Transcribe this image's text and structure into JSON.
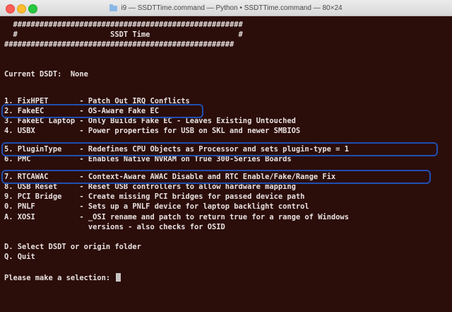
{
  "window": {
    "title": "i9 — SSDTTime.command — Python • SSDTTime.command — 80×24"
  },
  "terminal": {
    "hash_line_1": "  ####################################################",
    "header_line": "  #                     SSDT Time                    #",
    "hash_line_2": "####################################################",
    "current_dsdt": "Current DSDT:  None",
    "menu": [
      "1. FixHPET       - Patch Out IRQ Conflicts",
      "2. FakeEC        - OS-Aware Fake EC",
      "3. FakeEC Laptop - Only Builds Fake EC - Leaves Existing Untouched",
      "4. USBX          - Power properties for USB on SKL and newer SMBIOS",
      "5. PluginType    - Redefines CPU Objects as Processor and sets plugin-type = 1",
      "6. PMC           - Enables Native NVRAM on True 300-Series Boards",
      "7. RTCAWAC       - Context-Aware AWAC Disable and RTC Enable/Fake/Range Fix",
      "8. USB Reset     - Reset USB controllers to allow hardware mapping",
      "9. PCI Bridge    - Create missing PCI bridges for passed device path",
      "0. PNLF          - Sets up a PNLF device for laptop backlight control",
      "A. XOSI          - _OSI rename and patch to return true for a range of Windows",
      "                   versions - also checks for OSID"
    ],
    "select_option": "D. Select DSDT or origin folder",
    "quit_option": "Q. Quit",
    "prompt": "Please make a selection: "
  },
  "colors": {
    "background": "#2b0d0a",
    "text": "#e8e2e0",
    "highlight_outline": "#1f4fb0"
  }
}
